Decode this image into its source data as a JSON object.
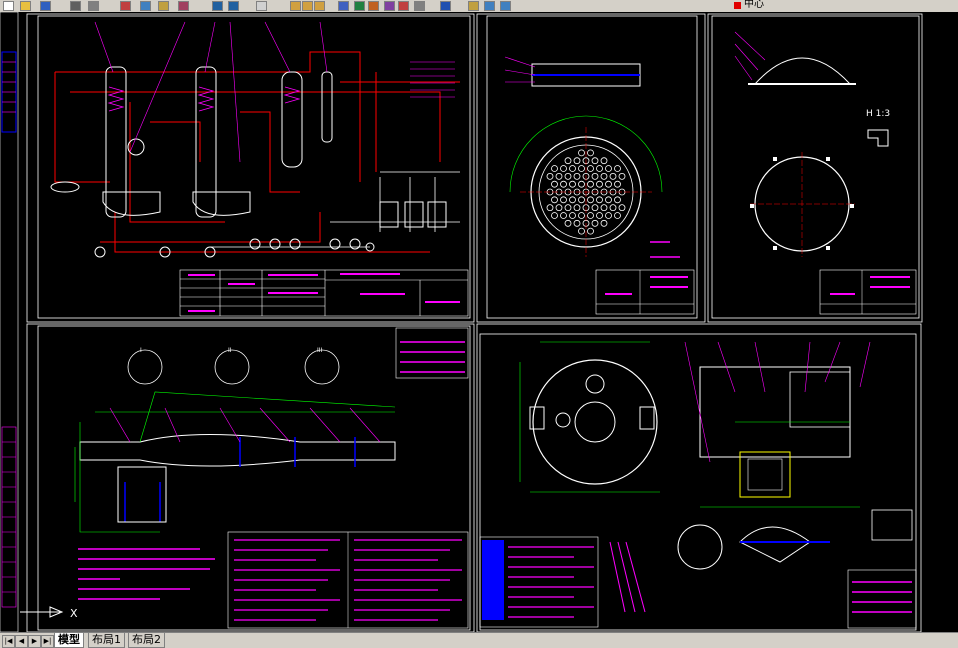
{
  "toolbar": {
    "layer_name": "中心",
    "layer_color": "#e00000",
    "buttons": [
      "new-icon",
      "open-icon",
      "save-icon",
      "print-icon",
      "preview-icon",
      "cut-icon",
      "copy-icon",
      "paste-icon",
      "matchprop-icon",
      "undo-icon",
      "redo-icon",
      "pan-icon",
      "zoom-realtime-icon",
      "zoom-window-icon",
      "zoom-previous-icon",
      "properties-icon",
      "designcenter-icon",
      "toolpalette-icon",
      "sheetset-icon",
      "markup-icon",
      "calc-icon",
      "help-icon",
      "layer-icon",
      "layer-state-icon",
      "layer-prev-icon"
    ]
  },
  "drawing": {
    "sheet1_detail_labels": [
      "I",
      "II",
      "III"
    ],
    "scale_label": "H 1:3",
    "ucs_label": "X",
    "accent_colors": {
      "frame": "#ffffff",
      "pipes": "#ff0000",
      "equip": "#ffffff",
      "leaders": "#ff00ff",
      "dims": "#00ff00",
      "hatch": "#0000ff",
      "alt": "#ffff00",
      "cyan": "#00ffff"
    }
  },
  "tabs": [
    {
      "label": "模型",
      "active": true
    },
    {
      "label": "布局1",
      "active": false
    },
    {
      "label": "布局2",
      "active": false
    }
  ],
  "nav": {
    "first": "|◀",
    "prev": "◀",
    "next": "▶",
    "last": "▶|"
  }
}
